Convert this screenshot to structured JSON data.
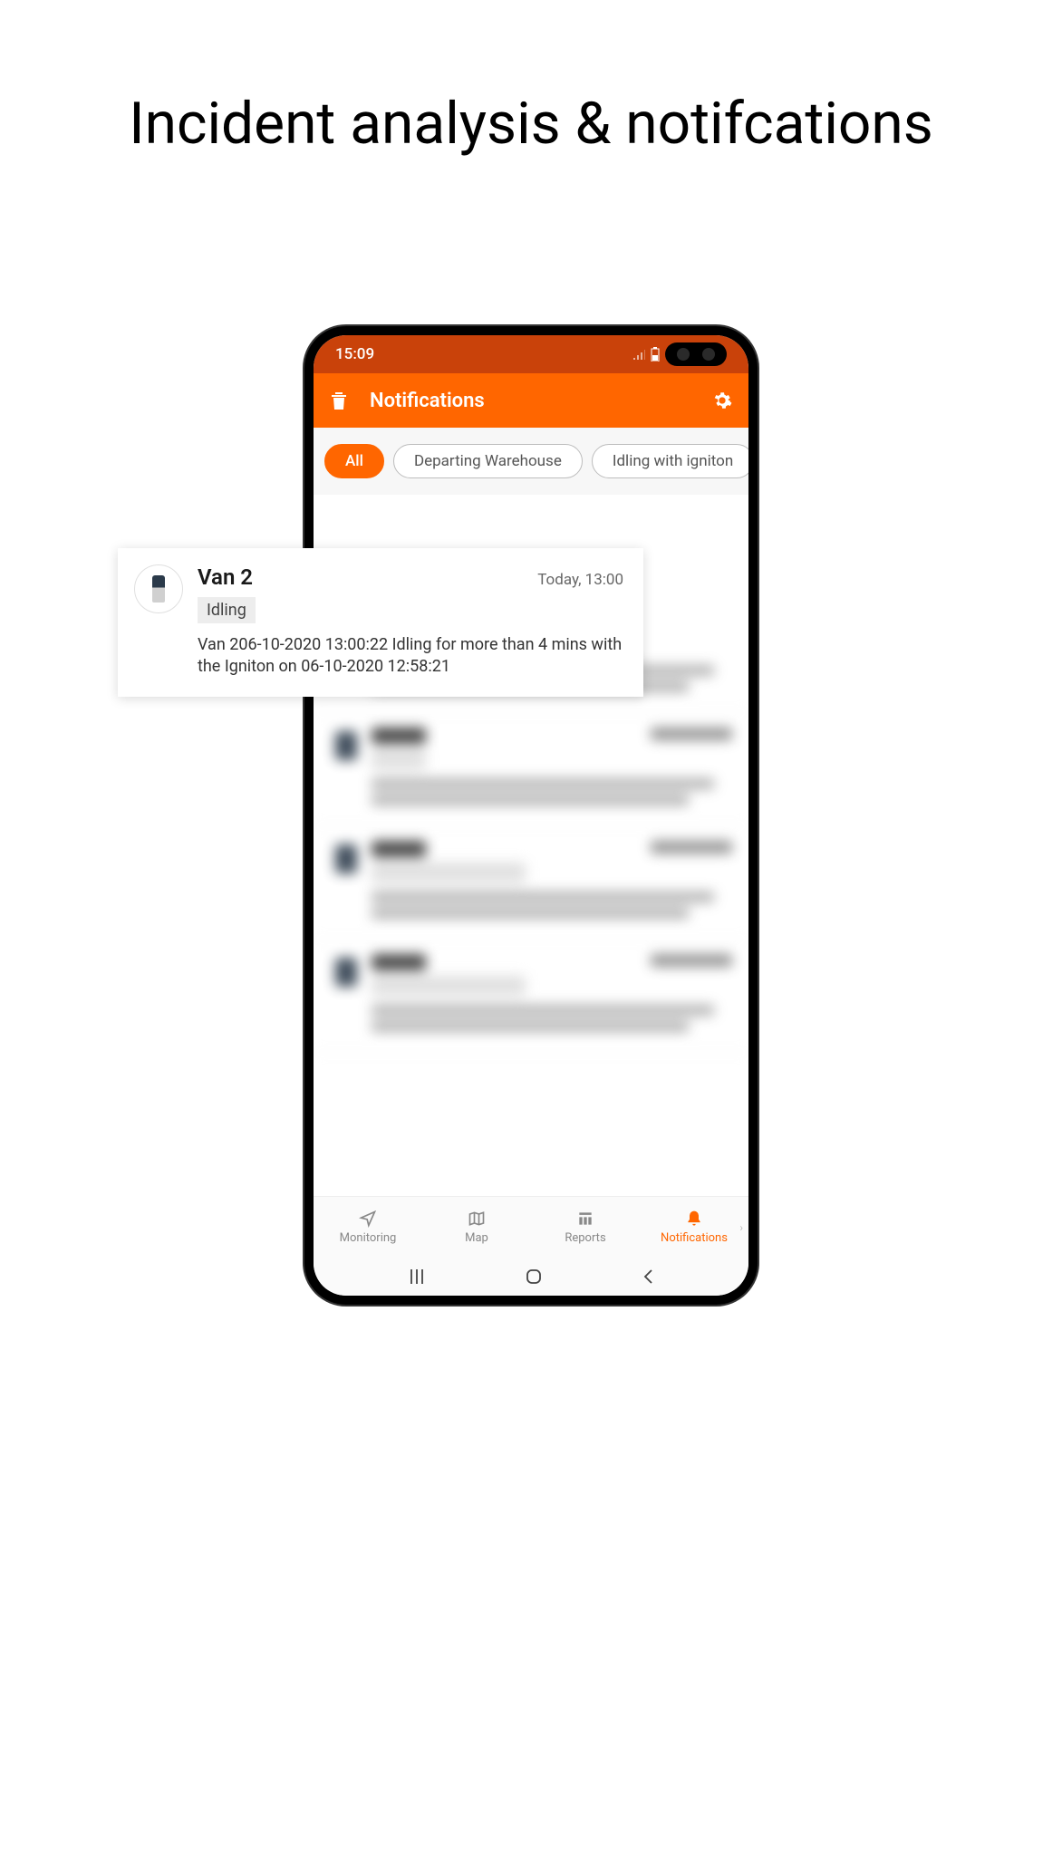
{
  "page_title": "Incident analysis & notifcations",
  "status_bar": {
    "time": "15:09"
  },
  "app_bar": {
    "title": "Notifications"
  },
  "filters": [
    {
      "label": "All",
      "active": true
    },
    {
      "label": "Departing Warehouse",
      "active": false
    },
    {
      "label": "Idling with igniton",
      "active": false
    }
  ],
  "featured_notification": {
    "vehicle": "Van 2",
    "timestamp": "Today, 13:00",
    "tag": "Idling",
    "description": "Van 206-10-2020 13:00:22 Idling  for more than 4 mins with the Igniton on 06-10-2020 12:58:21"
  },
  "bottom_nav": {
    "items": [
      {
        "label": "Monitoring",
        "icon": "navigate-icon"
      },
      {
        "label": "Map",
        "icon": "map-icon"
      },
      {
        "label": "Reports",
        "icon": "reports-icon"
      },
      {
        "label": "Notifications",
        "icon": "bell-icon",
        "active": true
      }
    ]
  }
}
